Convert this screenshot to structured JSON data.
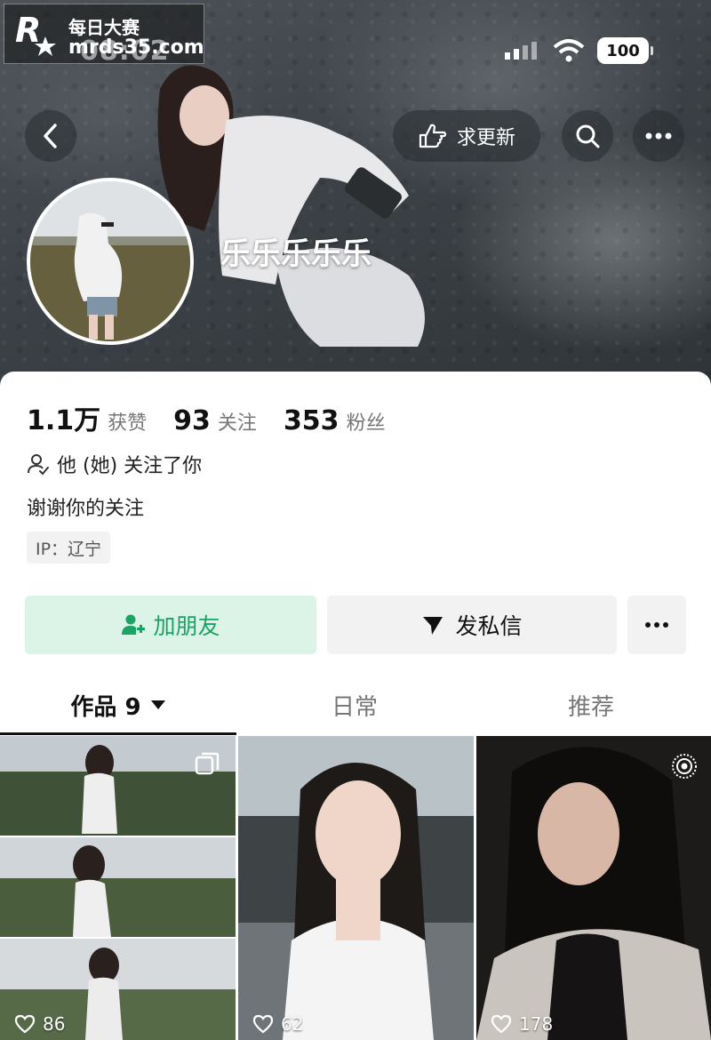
{
  "watermark": {
    "line1": "每日大赛",
    "line2": "mrds35.com",
    "logo_small": "每日大赛"
  },
  "status_bar": {
    "time": "08:02",
    "battery": "100"
  },
  "header": {
    "request_update_label": "求更新",
    "username": "乐乐乐乐乐"
  },
  "stats": [
    {
      "value": "1.1万",
      "label": "获赞"
    },
    {
      "value": "93",
      "label": "关注"
    },
    {
      "value": "353",
      "label": "粉丝"
    }
  ],
  "profile": {
    "follows_you": "他 (她) 关注了你",
    "bio": "谢谢你的关注",
    "ip": "IP：辽宁"
  },
  "actions": {
    "add_friend": "加朋友",
    "message": "发私信"
  },
  "tabs": [
    {
      "label": "作品 9",
      "active": true
    },
    {
      "label": "日常",
      "active": false
    },
    {
      "label": "推荐",
      "active": false
    }
  ],
  "posts": [
    {
      "likes": "86",
      "badge": "multi-image-icon"
    },
    {
      "likes": "62",
      "badge": ""
    },
    {
      "likes": "178",
      "badge": "live-photo-icon"
    }
  ],
  "colors": {
    "accent_green": "#19a463",
    "add_friend_bg": "#dcf3e7",
    "button_gray": "#f2f2f2"
  }
}
